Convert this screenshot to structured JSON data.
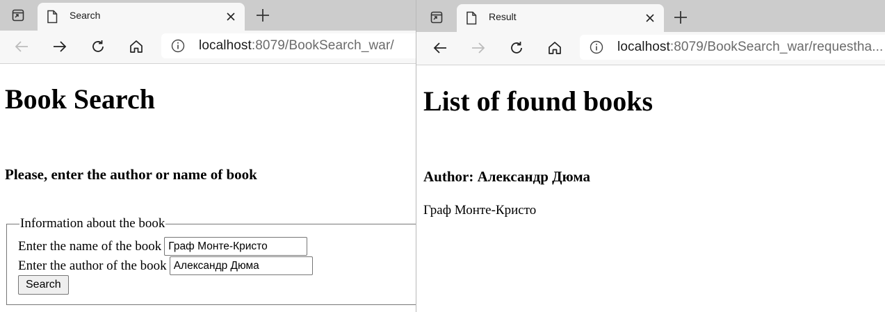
{
  "left_window": {
    "tab": {
      "title": "Search"
    },
    "address": {
      "host": "localhost",
      "path": ":8079/BookSearch_war/"
    },
    "page": {
      "heading": "Book Search",
      "subheading": "Please, enter the author or name of book",
      "fieldset": {
        "legend": "Information about the book",
        "name_label": "Enter the name of the book",
        "name_value": "Граф Монте-Кристо",
        "author_label": "Enter the author of the book",
        "author_value": "Александр Дюма",
        "button_label": "Search"
      }
    }
  },
  "right_window": {
    "tab": {
      "title": "Result"
    },
    "address": {
      "host": "localhost",
      "path": ":8079/BookSearch_war/requestha..."
    },
    "page": {
      "heading": "List of found books",
      "author_line": "Author: Александр Дюма",
      "book_title": "Граф Монте-Кристо"
    }
  },
  "icons": {
    "tab_actions": "tab-actions-icon",
    "favicon": "page-icon",
    "close": "close-icon",
    "new_tab": "plus-icon",
    "back": "back-arrow-icon",
    "forward": "forward-arrow-icon",
    "refresh": "refresh-icon",
    "home": "home-icon",
    "site_info": "info-icon"
  }
}
